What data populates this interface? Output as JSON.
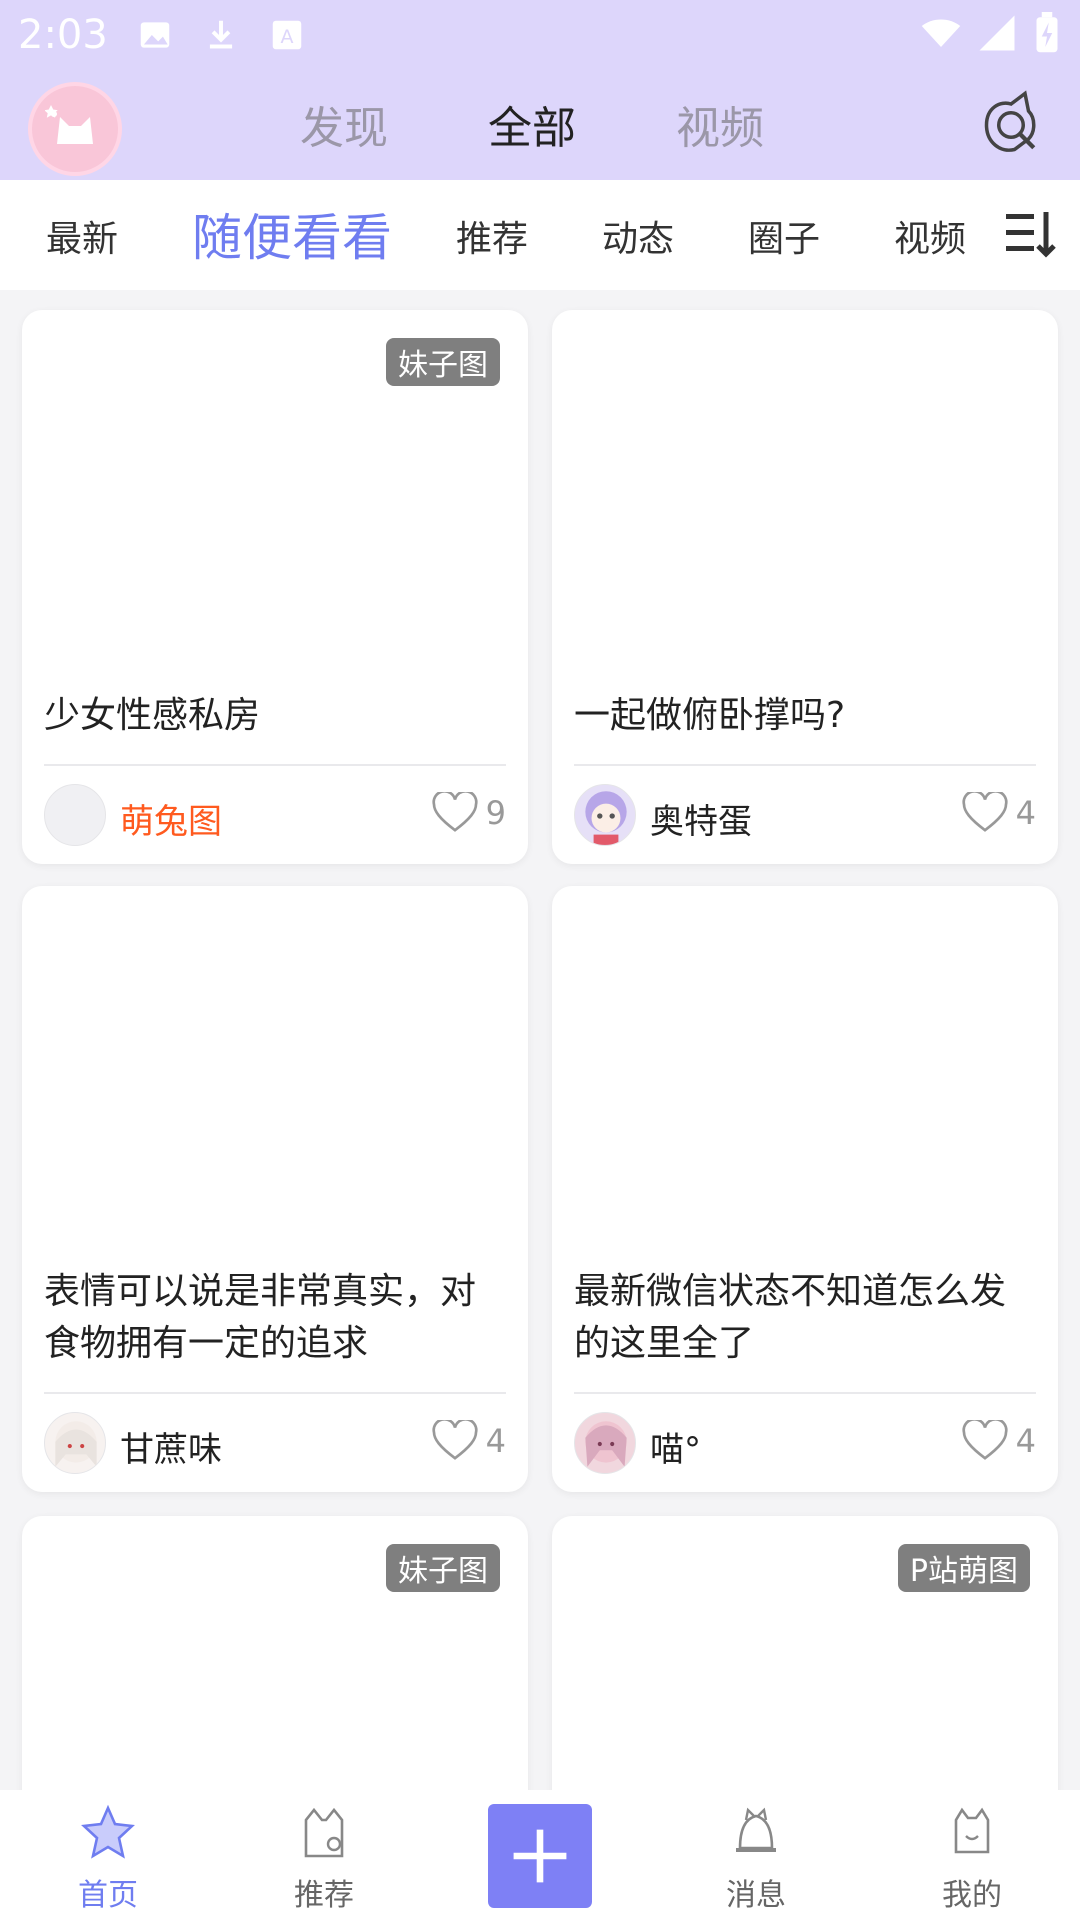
{
  "statusbar": {
    "time": "2:03"
  },
  "header": {
    "tabs": [
      {
        "label": "发现"
      },
      {
        "label": "全部"
      },
      {
        "label": "视频"
      }
    ]
  },
  "subtabs": {
    "items": [
      {
        "label": "最新"
      },
      {
        "label": "随便看看"
      },
      {
        "label": "推荐"
      },
      {
        "label": "动态"
      },
      {
        "label": "圈子"
      },
      {
        "label": "视频"
      }
    ]
  },
  "feed": {
    "cards": [
      {
        "tag": "妹子图",
        "title": "少女性感私房",
        "author": "萌兔图",
        "likes": "9"
      },
      {
        "tag": "",
        "title": "一起做俯卧撑吗?",
        "author": "奥特蛋",
        "likes": "4"
      },
      {
        "tag": "",
        "title": "表情可以说是非常真实，对食物拥有一定的追求",
        "author": "甘蔗味",
        "likes": "4"
      },
      {
        "tag": "",
        "title": "最新微信状态不知道怎么发的这里全了",
        "author": "喵°",
        "likes": "4"
      },
      {
        "tag": "妹子图",
        "title": "",
        "author": "",
        "likes": ""
      },
      {
        "tag": "P站萌图",
        "title": "",
        "author": "",
        "likes": ""
      }
    ]
  },
  "bottomnav": {
    "items": [
      {
        "label": "首页"
      },
      {
        "label": "推荐"
      },
      {
        "label": "消息"
      },
      {
        "label": "我的"
      }
    ]
  },
  "colors": {
    "accent": "#6f7df0",
    "header_bg": "#ddd6fb",
    "plus": "#7e80f5",
    "highlight_name": "#ff5a1f"
  }
}
